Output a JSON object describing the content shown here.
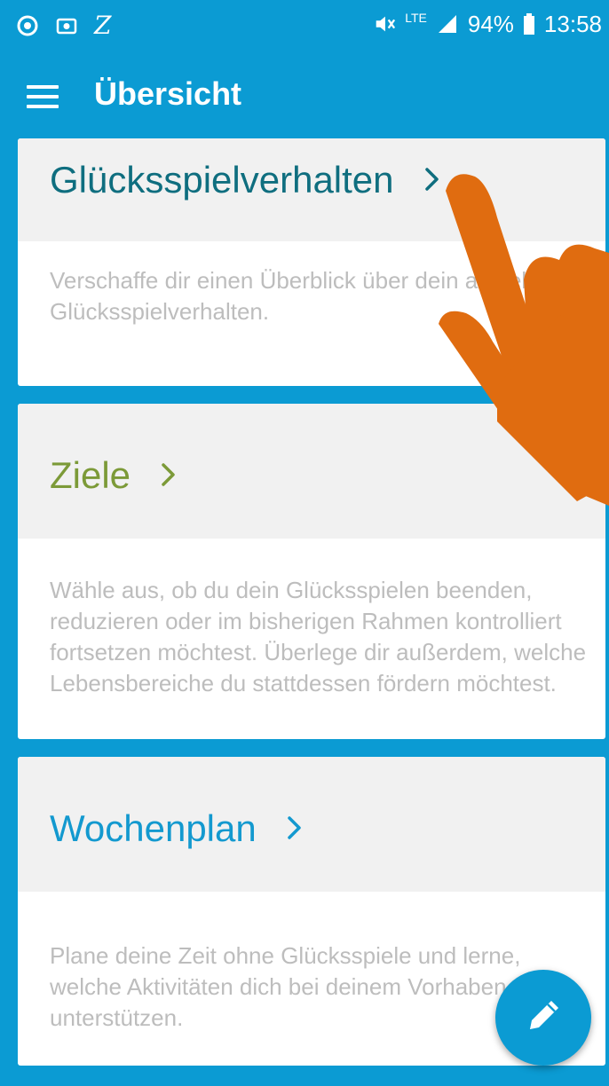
{
  "status_bar": {
    "z_label": "Z",
    "network": "LTE",
    "battery": "94%",
    "time": "13:58"
  },
  "app_bar": {
    "title": "Übersicht",
    "menu_icon": "hamburger-menu-icon"
  },
  "cards": [
    {
      "title": "Glücksspielverhalten",
      "description": "Verschaffe dir einen Überblick über dein aktuelles Glücksspielverhalten.",
      "color": "#0f6e7f"
    },
    {
      "title": "Ziele",
      "description": "Wähle aus, ob du dein Glücksspielen beenden, reduzieren oder im bisherigen Rahmen kontrolliert fortsetzen möchtest. Überlege dir außerdem, welche Lebensbereiche du stattdessen fördern möchtest.",
      "color": "#7c9a38"
    },
    {
      "title": "Wochenplan",
      "description": "Plane deine Zeit ohne Glücksspiele und lerne, welche Aktivitäten dich bei deinem Vorhaben unterstützen.",
      "color": "#1399cf"
    }
  ],
  "fab": {
    "icon": "edit-pencil-icon"
  },
  "colors": {
    "primary": "#0b9bd3",
    "card_header_bg": "#f1f1f1",
    "body_text": "#bdbdbd",
    "hand_overlay": "#e06c10"
  }
}
